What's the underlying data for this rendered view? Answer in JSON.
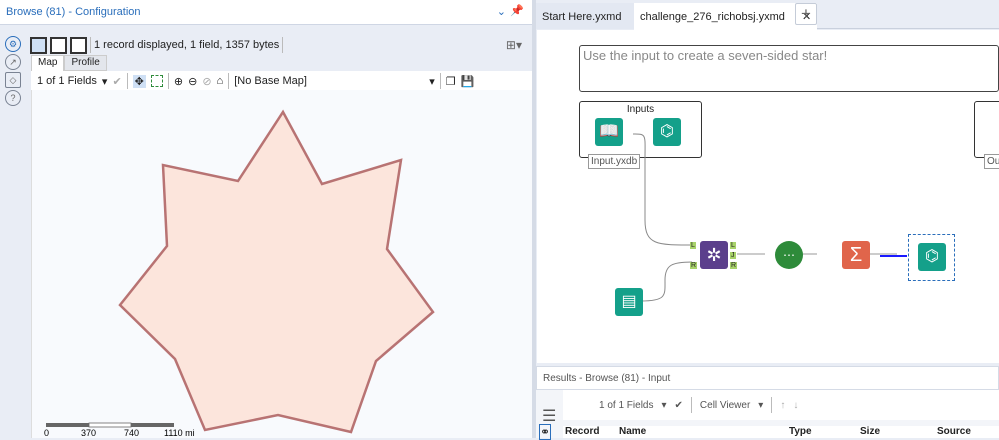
{
  "config": {
    "title": "Browse (81) - Configuration",
    "status": "1 record displayed, 1 field, 1357 bytes",
    "tabs": [
      "Map",
      "Profile"
    ],
    "fields_selector": "1 of 1 Fields",
    "base_map": "[No Base Map]",
    "scale": {
      "labels": [
        "0",
        "370",
        "740",
        "1110 mi"
      ]
    }
  },
  "workflow": {
    "tabs": [
      {
        "label": "Start Here.yxmd",
        "close": "✕"
      },
      {
        "label": "challenge_276_richobsj.yxmd",
        "close": "✕"
      }
    ],
    "add_tab": "+",
    "comment": "Use the input to create a seven-sided star!",
    "container_title": "Inputs",
    "input_label": "Input.yxdb",
    "output_label": "Out",
    "join_anchors": {
      "in": [
        "L",
        "R"
      ],
      "out": [
        "L",
        "J",
        "R"
      ]
    }
  },
  "results": {
    "title": "Results - Browse (81) - Input",
    "fields_selector": "1 of 1 Fields",
    "viewer": "Cell Viewer",
    "columns": [
      "Record",
      "Name",
      "Type",
      "Size",
      "Source"
    ]
  },
  "colors": {
    "accent": "#2a6ebb",
    "star_fill": "#fce5dc",
    "star_stroke": "#b87373",
    "teal": "#14a08a",
    "purple": "#5b3f8c",
    "green": "#2e8b3a",
    "orange": "#e0654b"
  }
}
